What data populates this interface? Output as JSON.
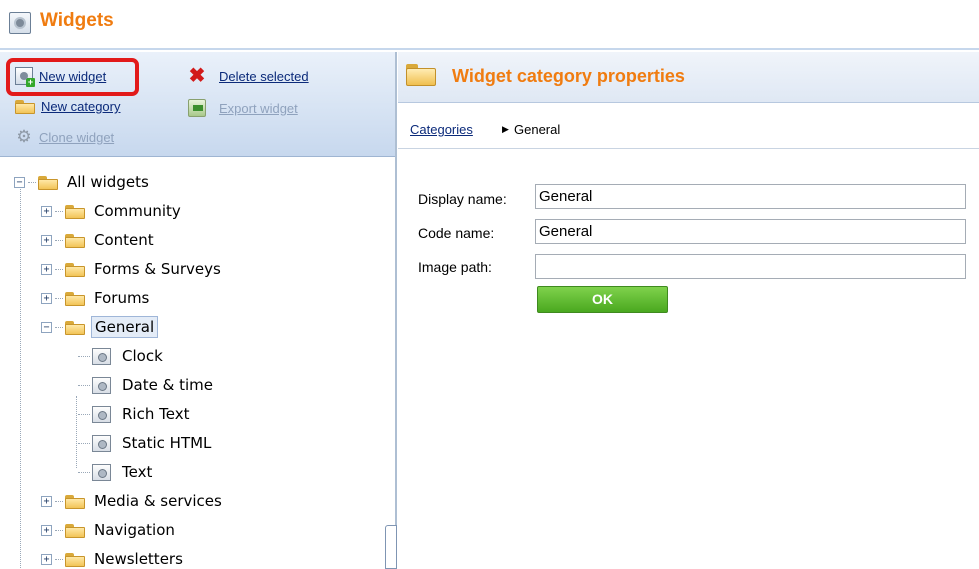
{
  "header": {
    "title": "Widgets",
    "logo_icon": "widget-gear-icon",
    "accent_color": "#f07c10"
  },
  "toolbar": {
    "new_widget": "New widget",
    "delete_selected": "Delete selected",
    "new_category": "New category",
    "export_widget": "Export widget",
    "clone_widget": "Clone widget",
    "highlight_color": "#e21a1a"
  },
  "tree": {
    "root": "All widgets",
    "categories": [
      "Community",
      "Content",
      "Forms & Surveys",
      "Forums",
      "General",
      "Media & services",
      "Navigation",
      "Newsletters"
    ],
    "selected": "General",
    "general_children": [
      "Clock",
      "Date & time",
      "Rich Text",
      "Static HTML",
      "Text"
    ]
  },
  "properties": {
    "title": "Widget category properties",
    "breadcrumb_link": "Categories",
    "breadcrumb_current": "General",
    "display_name_label": "Display name:",
    "display_name_value": "General",
    "code_name_label": "Code name:",
    "code_name_value": "General",
    "image_path_label": "Image path:",
    "image_path_value": "",
    "ok_label": "OK"
  }
}
